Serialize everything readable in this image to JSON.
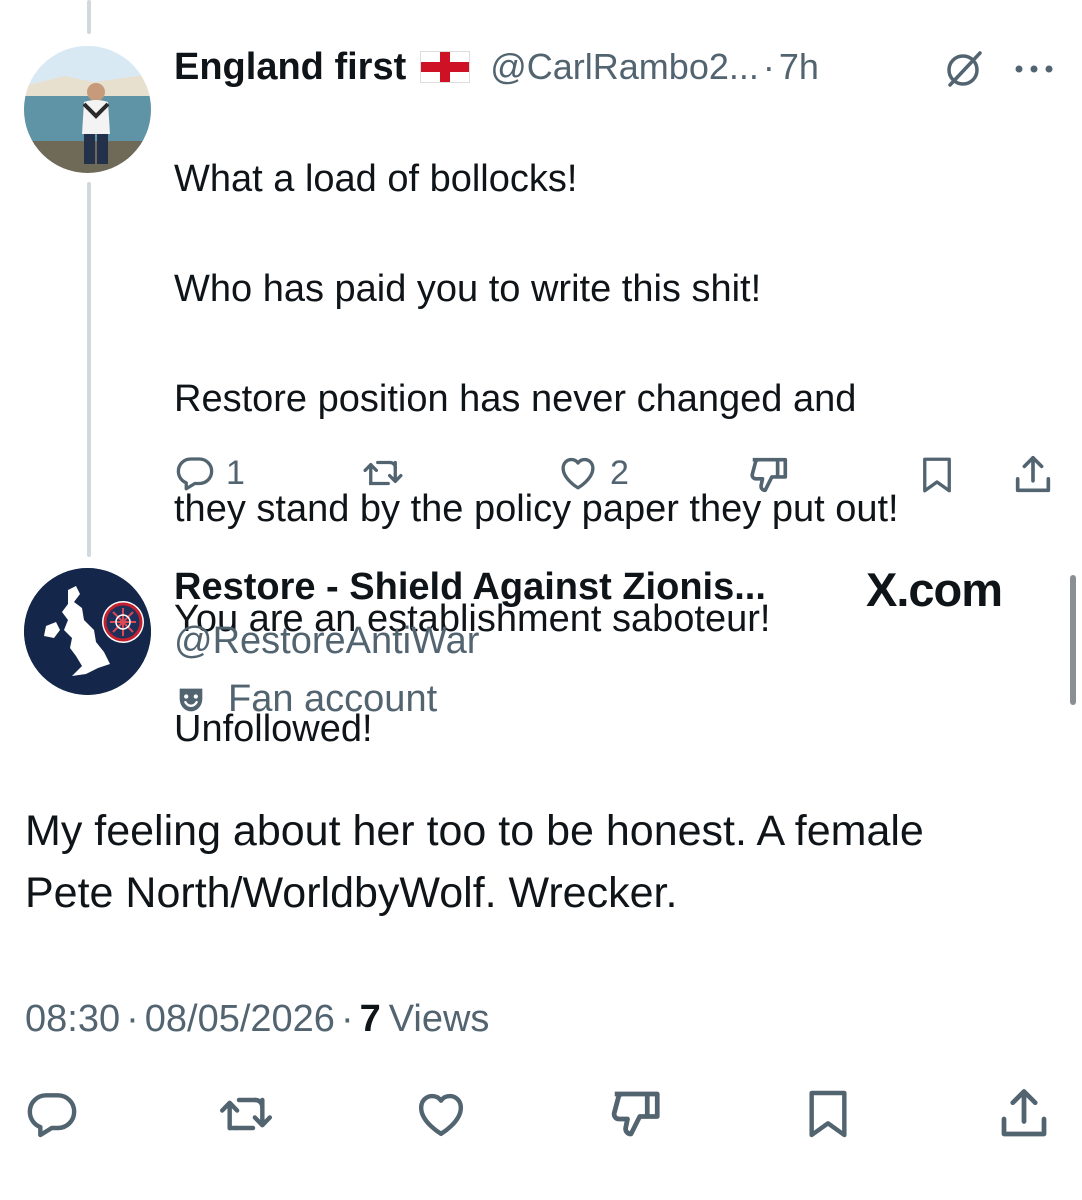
{
  "reply": {
    "author_name": "England first",
    "handle": "@CarlRambo2...",
    "separator": "·",
    "time": "7h",
    "lines": [
      "What a load of bollocks!",
      "Who has paid you to write this shit!",
      "Restore position has never changed and",
      "they stand by the policy paper they put out!",
      "You are an establishment saboteur!",
      "Unfollowed!"
    ],
    "reply_count": "1",
    "like_count": "2"
  },
  "main_tweet": {
    "author_name": "Restore - Shield Against Zionis...",
    "handle": "@RestoreAntiWar",
    "account_label": "Fan account",
    "text_line1": "My feeling about her too to be honest. A female",
    "text_line2": "Pete North/WorldbyWolf. Wrecker.",
    "time": "08:30",
    "date": "08/05/2026",
    "views_count": "7",
    "views_label": "Views",
    "dot": "·"
  },
  "watermark": "X.com",
  "colors": {
    "text": "#0f1419",
    "muted": "#536471",
    "thread_line": "#cfd9de",
    "avatar2_bg": "#14274a",
    "flag_red": "#ce1124"
  }
}
